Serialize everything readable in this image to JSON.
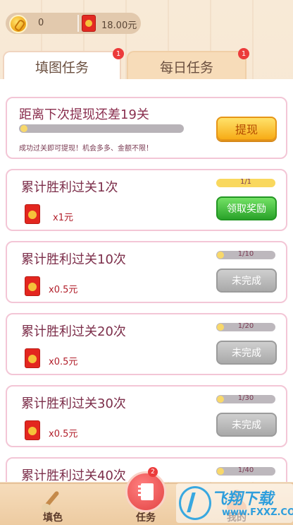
{
  "header": {
    "coins": "0",
    "cash": "18.00元"
  },
  "tabs": [
    {
      "label": "填图任务",
      "badge": "1"
    },
    {
      "label": "每日任务",
      "badge": "1"
    }
  ],
  "withdraw": {
    "title": "距离下次提现还差19关",
    "hint": "成功过关即可提现！机会多多、金额不限！",
    "button": "提现"
  },
  "tasks": [
    {
      "title": "累计胜利过关1次",
      "reward": "x1元",
      "progress": "1/1",
      "button": "领取奖励",
      "status": "claimable"
    },
    {
      "title": "累计胜利过关10次",
      "reward": "x0.5元",
      "progress": "1/10",
      "button": "未完成",
      "status": "incomplete"
    },
    {
      "title": "累计胜利过关20次",
      "reward": "x0.5元",
      "progress": "1/20",
      "button": "未完成",
      "status": "incomplete"
    },
    {
      "title": "累计胜利过关30次",
      "reward": "x0.5元",
      "progress": "1/30",
      "button": "未完成",
      "status": "incomplete"
    },
    {
      "title": "累计胜利过关40次",
      "progress": "1/40"
    }
  ],
  "bottom_nav": [
    {
      "label": "填色"
    },
    {
      "label": "任务",
      "badge": "2"
    },
    {
      "label": "我的"
    }
  ],
  "watermark": {
    "title": "飞翔下载",
    "sub": "www.FXXZ.COM"
  }
}
